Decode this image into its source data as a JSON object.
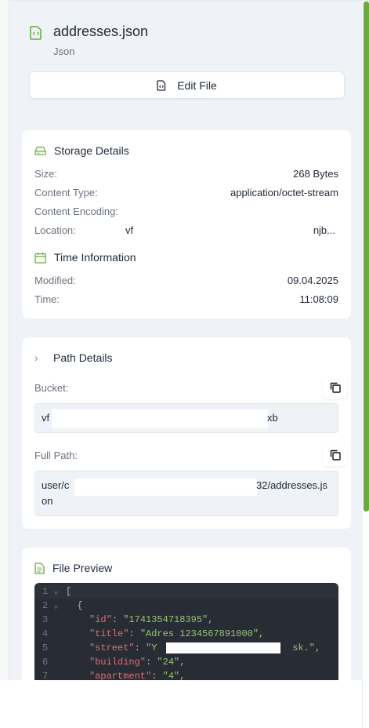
{
  "file": {
    "name": "addresses.json",
    "type": "Json",
    "edit_label": "Edit File"
  },
  "storage": {
    "title": "Storage Details",
    "rows": [
      {
        "label": "Size:",
        "value": "268 Bytes"
      },
      {
        "label": "Content Type:",
        "value": "application/octet-stream"
      },
      {
        "label": "Content Encoding:",
        "value": ""
      }
    ],
    "location": {
      "label": "Location:",
      "value_start": "vf",
      "value_end": "njb..."
    }
  },
  "time": {
    "title": "Time Information",
    "rows": [
      {
        "label": "Modified:",
        "value": "09.04.2025"
      },
      {
        "label": "Time:",
        "value": "11:08:09"
      }
    ]
  },
  "path": {
    "title": "Path Details",
    "bucket_label": "Bucket:",
    "bucket_start": "vf",
    "bucket_end": "xb",
    "full_path_label": "Full Path:",
    "full_path_start": "user/c",
    "full_path_end": "32/addresses.js",
    "full_path_wrap": "on"
  },
  "preview": {
    "title": "File Preview",
    "lines": [
      {
        "n": "1",
        "text": "["
      },
      {
        "n": "2",
        "text": "  {"
      },
      {
        "n": "3",
        "key": "\"id\"",
        "val": "\"1741354718395\","
      },
      {
        "n": "4",
        "key": "\"title\"",
        "val": "\"Adres 1234567891000\","
      },
      {
        "n": "5",
        "key": "\"street\"",
        "val_start": "\"Y",
        "val_end": " sk.\","
      },
      {
        "n": "6",
        "key": "\"building\"",
        "val": "\"24\","
      },
      {
        "n": "7",
        "key": "\"apartment\"",
        "val": "\"4\","
      }
    ]
  },
  "colors": {
    "accent": "#6aac3c",
    "code_bg": "#282c34",
    "json_key": "#e06c75",
    "json_string": "#98c379"
  }
}
